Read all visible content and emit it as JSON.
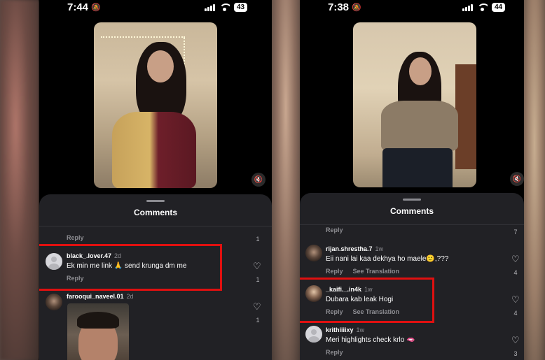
{
  "left_phone": {
    "time": "7:44",
    "battery": "43",
    "sheet_title": "Comments",
    "top_reply": {
      "reply_label": "Reply",
      "likes": "1"
    },
    "comments": [
      {
        "username": "black_.lover.47",
        "age": "2d",
        "text": "Ek min me link 🙏 send krunga dm me",
        "reply_label": "Reply",
        "likes": "1"
      },
      {
        "username": "farooqui_naveel.01",
        "age": "2d",
        "likes": "1"
      }
    ]
  },
  "right_phone": {
    "time": "7:38",
    "battery": "44",
    "sheet_title": "Comments",
    "top_reply": {
      "reply_label": "Reply",
      "likes": "7"
    },
    "comments": [
      {
        "username": "rijan.shrestha.7",
        "age": "1w",
        "text": "Eii nani lai kaa dekhya ho maele🙂,???",
        "reply_label": "Reply",
        "translate_label": "See Translation",
        "likes": "4"
      },
      {
        "username": "_kaifi._.in4k",
        "age": "1w",
        "text": "Dubara kab leak Hogi",
        "reply_label": "Reply",
        "translate_label": "See Translation",
        "likes": "4"
      },
      {
        "username": "krithiiiixy",
        "age": "1w",
        "text": "Meri highlights check krlo 🫦",
        "reply_label": "Reply",
        "likes": "3"
      }
    ]
  },
  "colors": {
    "highlight": "#e01010",
    "sheet_bg": "#212125",
    "muted_text": "#8e8e93"
  },
  "icons": [
    "bell-slash-icon",
    "signal-icon",
    "wifi-icon",
    "battery-icon",
    "mute-icon",
    "heart-icon",
    "avatar-icon"
  ]
}
